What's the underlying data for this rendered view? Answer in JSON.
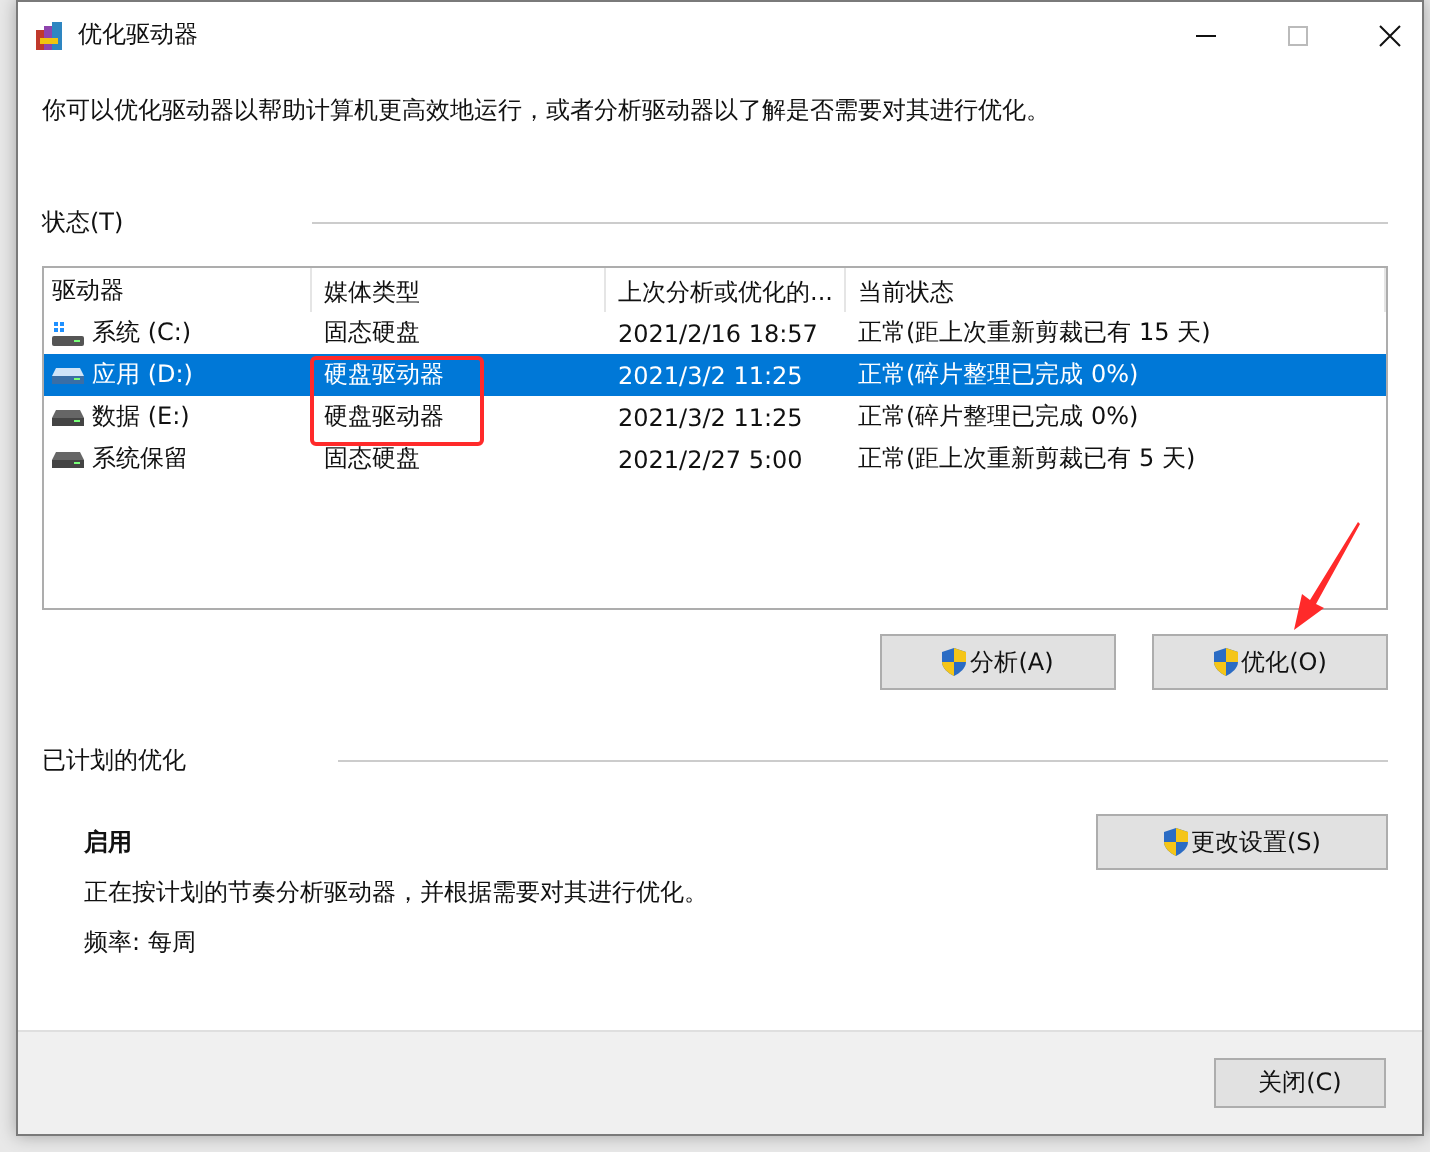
{
  "window": {
    "title": "优化驱动器"
  },
  "intro": "你可以优化驱动器以帮助计算机更高效地运行，或者分析驱动器以了解是否需要对其进行优化。",
  "status_section": {
    "title": "状态(T)"
  },
  "table": {
    "columns": [
      "驱动器",
      "媒体类型",
      "上次分析或优化的...",
      "当前状态"
    ],
    "rows": [
      {
        "kind": "system",
        "drive": "系统 (C:)",
        "media": "固态硬盘",
        "last": "2021/2/16 18:57",
        "status": "正常(距上次重新剪裁已有 15 天)",
        "selected": false
      },
      {
        "kind": "drive",
        "drive": "应用 (D:)",
        "media": "硬盘驱动器",
        "last": "2021/3/2 11:25",
        "status": "正常(碎片整理已完成 0%)",
        "selected": true
      },
      {
        "kind": "drive",
        "drive": "数据 (E:)",
        "media": "硬盘驱动器",
        "last": "2021/3/2 11:25",
        "status": "正常(碎片整理已完成 0%)",
        "selected": false
      },
      {
        "kind": "drive",
        "drive": "系统保留",
        "media": "固态硬盘",
        "last": "2021/2/27 5:00",
        "status": "正常(距上次重新剪裁已有 5 天)",
        "selected": false
      }
    ]
  },
  "actions": [
    "分析(A)",
    "优化(O)"
  ],
  "schedule": {
    "title": "已计划的优化",
    "state": "启用",
    "description": "正在按计划的节奏分析驱动器，并根据需要对其进行优化。",
    "frequency": "频率: 每周",
    "button": "更改设置(S)"
  },
  "footer": {
    "button": "关闭(C)"
  }
}
